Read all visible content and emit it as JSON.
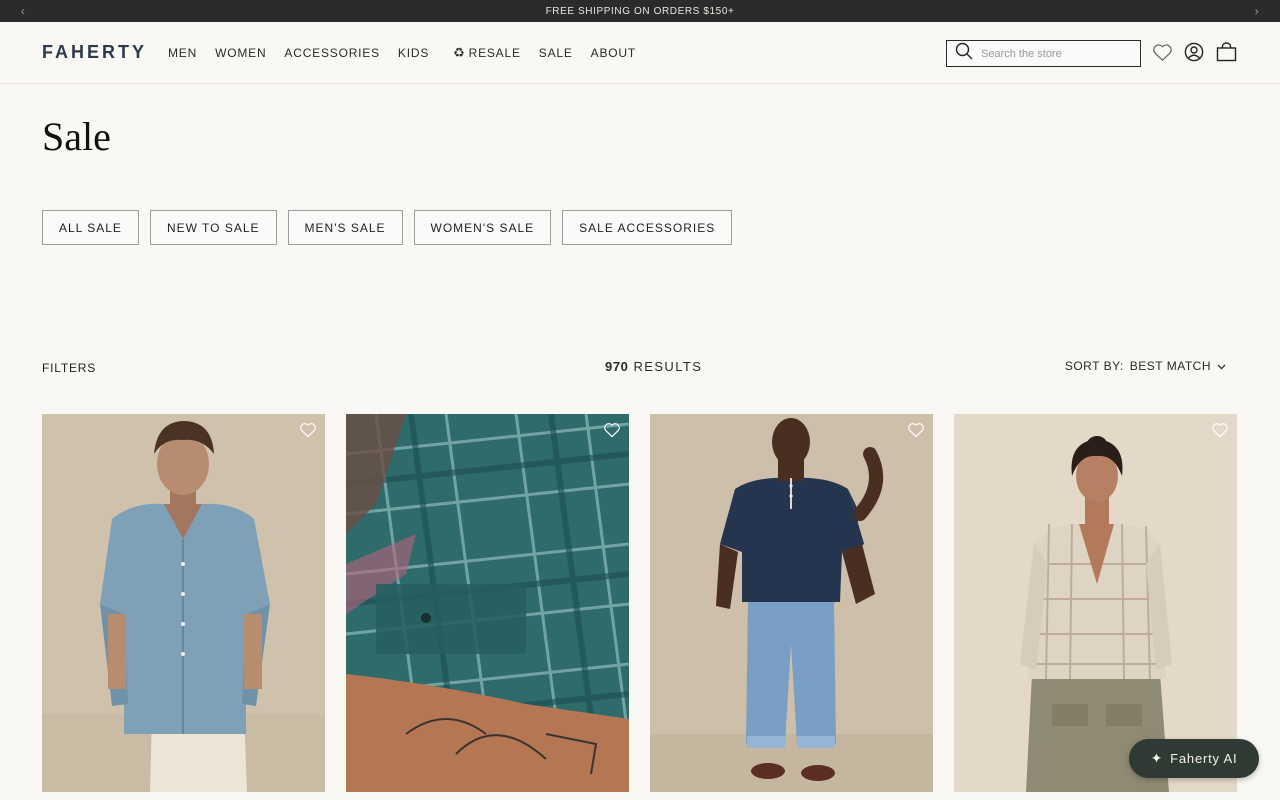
{
  "announcement": {
    "text": "FREE SHIPPING ON ORDERS $150+",
    "prev": "‹",
    "next": "›"
  },
  "header": {
    "logo": "FAHERTY",
    "nav": [
      "MEN",
      "WOMEN",
      "ACCESSORIES",
      "KIDS",
      "RESALE",
      "SALE",
      "ABOUT"
    ],
    "resale_icon": "♻",
    "search_placeholder": "Search the store",
    "icons": [
      "search-icon",
      "heart-icon",
      "account-icon",
      "bag-icon"
    ]
  },
  "page": {
    "title": "Sale"
  },
  "categories": [
    "ALL SALE",
    "NEW TO SALE",
    "MEN'S SALE",
    "WOMEN'S SALE",
    "SALE ACCESSORIES"
  ],
  "toolbar": {
    "filters_label": "FILTERS",
    "results_count": "970",
    "results_label": "RESULTS",
    "sort_label": "SORT BY:",
    "sort_value": "BEST MATCH"
  },
  "products": [
    {
      "image": "model in light blue short-sleeve printed shirt and cream pants"
    },
    {
      "image": "close-up of teal plaid shirt pocket with tattooed arm"
    },
    {
      "image": "model in navy henley tee and light wash jeans"
    },
    {
      "image": "model in cream plaid button-up shirt and olive pants"
    }
  ],
  "assistant": {
    "label": "Faherty AI",
    "icon": "sparkle-icon"
  },
  "colors": {
    "announcement_bg": "#2b2b2b",
    "page_bg": "#f9f8f5",
    "logo": "#2c3a4b",
    "assistant_bg": "#2f3a35"
  }
}
